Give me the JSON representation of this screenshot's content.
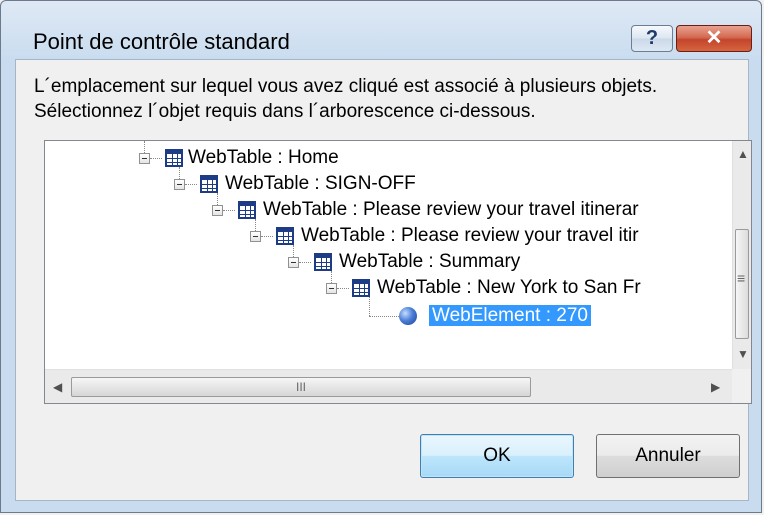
{
  "window": {
    "title": "Point de contrôle standard",
    "help_label": "?",
    "close_label": "✕"
  },
  "message": {
    "line1": "L´emplacement sur lequel vous avez cliqué est associé à plusieurs objets.",
    "line2": "Sélectionnez l´objet requis dans l´arborescence ci-dessous."
  },
  "tree": {
    "items": [
      {
        "label": "WebTable : Home",
        "icon": "table-icon",
        "level": 0,
        "selected": false
      },
      {
        "label": "WebTable : SIGN-OFF",
        "icon": "table-icon",
        "level": 1,
        "selected": false
      },
      {
        "label": "WebTable : Please review your travel itinerar",
        "icon": "table-icon",
        "level": 2,
        "selected": false
      },
      {
        "label": "WebTable : Please review your travel itir",
        "icon": "table-icon",
        "level": 3,
        "selected": false
      },
      {
        "label": "WebTable : Summary",
        "icon": "table-icon",
        "level": 4,
        "selected": false
      },
      {
        "label": "WebTable : New York to San Fr",
        "icon": "table-icon",
        "level": 5,
        "selected": false
      },
      {
        "label": "WebElement : 270",
        "icon": "globe-icon",
        "level": 6,
        "selected": true
      }
    ],
    "hscroll_grip": "III"
  },
  "buttons": {
    "ok": "OK",
    "cancel": "Annuler"
  }
}
